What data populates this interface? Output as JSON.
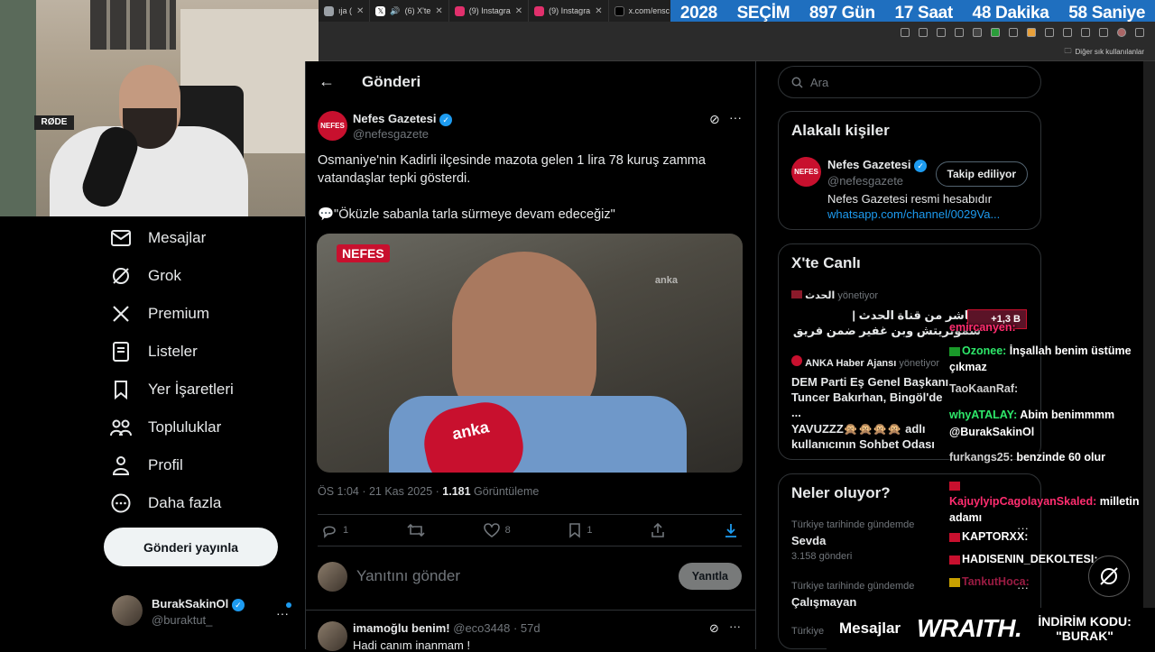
{
  "browser": {
    "tabs": [
      {
        "label": "ıja (",
        "color": "#9aa0a6"
      },
      {
        "label": "(6) X'te",
        "color": "#ffffff"
      },
      {
        "label": "(9) Instagra",
        "color": "#e1306c"
      },
      {
        "label": "(9) Instagra",
        "color": "#e1306c"
      },
      {
        "label": "x.com/ensc",
        "color": "#ffffff"
      }
    ],
    "bookmarks_label": "Diğer sık kullanılanlar"
  },
  "countdown": {
    "year": "2028",
    "event": "SEÇİM",
    "days": "897 Gün",
    "hours": "17 Saat",
    "minutes": "48 Dakika",
    "seconds": "58 Saniye"
  },
  "webcam": {
    "mic_brand": "RØDE"
  },
  "nav": {
    "items": [
      {
        "label": "Mesajlar",
        "icon": "envelope-icon"
      },
      {
        "label": "Grok",
        "icon": "grok-icon"
      },
      {
        "label": "Premium",
        "icon": "x-logo-icon"
      },
      {
        "label": "Listeler",
        "icon": "list-icon"
      },
      {
        "label": "Yer İşaretleri",
        "icon": "bookmark-icon"
      },
      {
        "label": "Topluluklar",
        "icon": "communities-icon"
      },
      {
        "label": "Profil",
        "icon": "profile-icon"
      },
      {
        "label": "Daha fazla",
        "icon": "more-circle-icon"
      }
    ],
    "post_button": "Gönderi yayınla",
    "account": {
      "name": "BurakSakinOl",
      "handle": "@buraktut_"
    }
  },
  "main": {
    "header_title": "Gönderi",
    "author": {
      "name": "Nefes Gazetesi",
      "handle": "@nefesgazete",
      "avatar_text": "NEFES"
    },
    "text_line1": "Osmaniye'nin Kadirli ilçesinde mazota gelen 1 lira 78 kuruş zamma vatandaşlar tepki gösterdi.",
    "text_line2": "💬\"Öküzle sabanla tarla sürmeye devam edeceğiz\"",
    "media": {
      "logo": "NEFES",
      "mic_text": "anka",
      "watermark": "anka"
    },
    "timestamp": "ÖS 1:04 · 21 Kas 2025",
    "separator": " · ",
    "views": "1.181",
    "views_label": "Görüntüleme",
    "stats": {
      "replies": "1",
      "likes": "8",
      "bookmarks": "1"
    },
    "reply_placeholder": "Yanıtını gönder",
    "reply_button": "Yanıtla",
    "comment": {
      "name": "imamoğlu benim!",
      "handle": "@eco3448",
      "time": "57d",
      "text": "Hadi canım inanmam !"
    }
  },
  "sidebar": {
    "search_placeholder": "Ara",
    "related": {
      "title": "Alakalı kişiler",
      "name": "Nefes Gazetesi",
      "handle": "@nefesgazete",
      "follow_label": "Takip ediliyor",
      "bio": "Nefes Gazetesi resmi hesabıdır",
      "link": "whatsapp.com/channel/0029Va..."
    },
    "live": {
      "title": "X'te Canlı",
      "items": [
        {
          "host": "الحدث",
          "role": "yönetiyor",
          "text": "مباشر من قناة الحدث | سموتريتش وبن غفير ضمن فريق وزاري يشرف"
        },
        {
          "host": "ANKA Haber Ajansı",
          "role": "yönetiyor",
          "text": "DEM Parti Eş Genel Başkanı Tuncer Bakırhan, Bingöl'de ..."
        },
        {
          "host": "",
          "role": "",
          "text": "YAVUZZZ🙊🙊🙊🙊 adlı kullanıcının Sohbet Odası"
        }
      ]
    },
    "trends": {
      "title": "Neler oluyor?",
      "items": [
        {
          "context": "Türkiye tarihinde gündemde",
          "name": "Sevda",
          "count": "3.158 gönderi"
        },
        {
          "context": "Türkiye tarihinde gündemde",
          "name": "Çalışmayan",
          "count": ""
        },
        {
          "context": "Türkiye t",
          "name": "",
          "count": ""
        }
      ]
    }
  },
  "chat": {
    "viewer_badge": "+1,3 B",
    "lines": [
      {
        "user": "emircanyen:",
        "msg": "",
        "user_color": "#ff2d6f"
      },
      {
        "user": "Ozonee:",
        "msg": "İnşallah benim üstüme çıkmaz",
        "user_color": "#2ee86a"
      },
      {
        "user": "TaoKaanRaf:",
        "msg": "",
        "user_color": "#cfcfcf"
      },
      {
        "user": "whyATALAY:",
        "msg": "Abim benimmmm",
        "user_color": "#2ee86a"
      },
      {
        "user": "@BurakSakinOl",
        "msg": "",
        "user_color": "#ffffff"
      },
      {
        "user": "furkangs25:",
        "msg": "benzinde 60 olur",
        "user_color": "#cfcfcf"
      },
      {
        "user": "KajuylyipCagolayanSkaled:",
        "msg": "milletin adamı",
        "user_color": "#ff2d6f"
      },
      {
        "user": "KAPTORXX:",
        "msg": "",
        "user_color": "#ffffff"
      },
      {
        "user": "HADISENIN_DEKOLTESI:",
        "msg": "",
        "user_color": "#ffffff"
      },
      {
        "user": "TankutHoca:",
        "msg": "",
        "user_color": "#ff2d6f"
      }
    ]
  },
  "bottom": {
    "messages_label": "Mesajlar",
    "brand": "WRAITH.",
    "promo_line1": "İNDİRİM KODU:",
    "promo_line2": "\"BURAK\""
  },
  "colors": {
    "accent": "#1d9bf0",
    "countdown_bg": "#1f6fbf",
    "brand_red": "#c8102e"
  }
}
